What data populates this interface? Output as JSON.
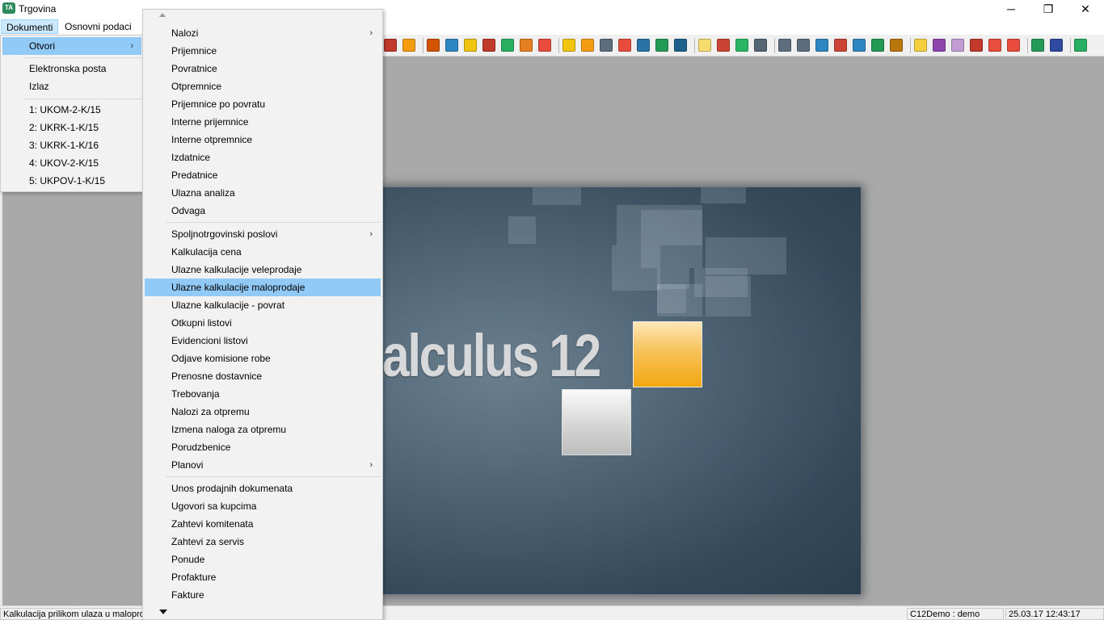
{
  "window": {
    "title": "Trgovina",
    "app_icon_text": "TA",
    "minimize_glyph": "─",
    "maximize_glyph": "❐",
    "close_glyph": "✕"
  },
  "menubar": {
    "items": [
      "Dokumenti",
      "Osnovni podaci"
    ]
  },
  "dokumenti_menu": {
    "items": [
      {
        "label": "Otvori",
        "submenu": true,
        "highlighted": true
      },
      {
        "label": "Elektronska posta"
      },
      {
        "label": "Izlaz"
      },
      {
        "label": "1: UKOM-2-K/15"
      },
      {
        "label": "2: UKRK-1-K/15"
      },
      {
        "label": "3: UKRK-1-K/16"
      },
      {
        "label": "4: UKOV-2-K/15"
      },
      {
        "label": "5: UKPOV-1-K/15"
      }
    ]
  },
  "otvori_menu": {
    "items": [
      {
        "label": "Nalozi",
        "submenu": true
      },
      {
        "label": "Prijemnice"
      },
      {
        "label": "Povratnice"
      },
      {
        "label": "Otpremnice"
      },
      {
        "label": "Prijemnice po povratu"
      },
      {
        "label": "Interne prijemnice"
      },
      {
        "label": "Interne otpremnice"
      },
      {
        "label": "Izdatnice"
      },
      {
        "label": "Predatnice"
      },
      {
        "label": "Ulazna analiza"
      },
      {
        "label": "Odvaga"
      },
      {
        "label": "Spoljnotrgovinski poslovi",
        "submenu": true
      },
      {
        "label": "Kalkulacija cena"
      },
      {
        "label": "Ulazne kalkulacije veleprodaje"
      },
      {
        "label": "Ulazne kalkulacije maloprodaje",
        "highlighted": true
      },
      {
        "label": "Ulazne kalkulacije - povrat"
      },
      {
        "label": "Otkupni listovi"
      },
      {
        "label": "Evidencioni listovi"
      },
      {
        "label": "Odjave komisione robe"
      },
      {
        "label": "Prenosne dostavnice"
      },
      {
        "label": "Trebovanja"
      },
      {
        "label": "Nalozi za otpremu"
      },
      {
        "label": "Izmena naloga za otpremu"
      },
      {
        "label": "Porudzbenice"
      },
      {
        "label": "Planovi",
        "submenu": true
      },
      {
        "label": "Unos prodajnih dokumenata"
      },
      {
        "label": "Ugovori sa kupcima"
      },
      {
        "label": "Zahtevi komitenata"
      },
      {
        "label": "Zahtevi za servis"
      },
      {
        "label": "Ponude"
      },
      {
        "label": "Profakture"
      },
      {
        "label": "Fakture"
      }
    ],
    "submenu_glyph": "›"
  },
  "splash": {
    "text": "alculus 12"
  },
  "statusbar": {
    "hint": "Kalkulacija prilikom ulaza u maloprodaju",
    "user": "C12Demo : demo",
    "datetime": "25.03.17 12:43:17"
  },
  "toolbar_icons": [
    {
      "name": "check-list-icon",
      "color": "#c0392b"
    },
    {
      "name": "star-icon",
      "color": "#f39c12"
    },
    {
      "name": "document-settings-icon",
      "color": "#d35400"
    },
    {
      "name": "folder-in-icon",
      "color": "#2e86c1"
    },
    {
      "name": "folder-arrow-icon",
      "color": "#f1c40f"
    },
    {
      "name": "folder-out-icon",
      "color": "#c0392b"
    },
    {
      "name": "folder-green-icon",
      "color": "#27ae60"
    },
    {
      "name": "folder-forward-icon",
      "color": "#e67e22"
    },
    {
      "name": "folder-back-icon",
      "color": "#e74c3c"
    },
    {
      "name": "mail-icon",
      "color": "#f1c40f"
    },
    {
      "name": "edit-icon",
      "color": "#f39c12"
    },
    {
      "name": "document-edit-icon",
      "color": "#5d6d7e"
    },
    {
      "name": "document-return-icon",
      "color": "#e74c3c"
    },
    {
      "name": "save-icon",
      "color": "#2874a6"
    },
    {
      "name": "save-green-icon",
      "color": "#229954"
    },
    {
      "name": "document-sign-icon",
      "color": "#1f618d"
    },
    {
      "name": "note-icon",
      "color": "#f7dc6f"
    },
    {
      "name": "screen-alert-icon",
      "color": "#cb4335"
    },
    {
      "name": "spreadsheet-icon",
      "color": "#28b463"
    },
    {
      "name": "grid-icon",
      "color": "#566573"
    },
    {
      "name": "window-icon",
      "color": "#5d6d7e"
    },
    {
      "name": "window-grid-icon",
      "color": "#5d6d7e"
    },
    {
      "name": "windows-stack-icon",
      "color": "#2e86c1"
    },
    {
      "name": "window-red-icon",
      "color": "#cb4335"
    },
    {
      "name": "window-list-icon",
      "color": "#2e86c1"
    },
    {
      "name": "window-green-icon",
      "color": "#229954"
    },
    {
      "name": "box-icon",
      "color": "#b9770e"
    },
    {
      "name": "lightbulb-icon",
      "color": "#f4d03f"
    },
    {
      "name": "gear-icon",
      "color": "#8e44ad"
    },
    {
      "name": "tag-icon",
      "color": "#c39bd3"
    },
    {
      "name": "document-red-icon",
      "color": "#c0392b"
    },
    {
      "name": "currency-icon",
      "color": "#e74c3c"
    },
    {
      "name": "heart-down-icon",
      "color": "#e74c3c"
    },
    {
      "name": "document-pin-icon",
      "color": "#239b56"
    },
    {
      "name": "help-icon",
      "color": "#2e4a9e"
    },
    {
      "name": "exit-icon",
      "color": "#27ae60"
    }
  ]
}
